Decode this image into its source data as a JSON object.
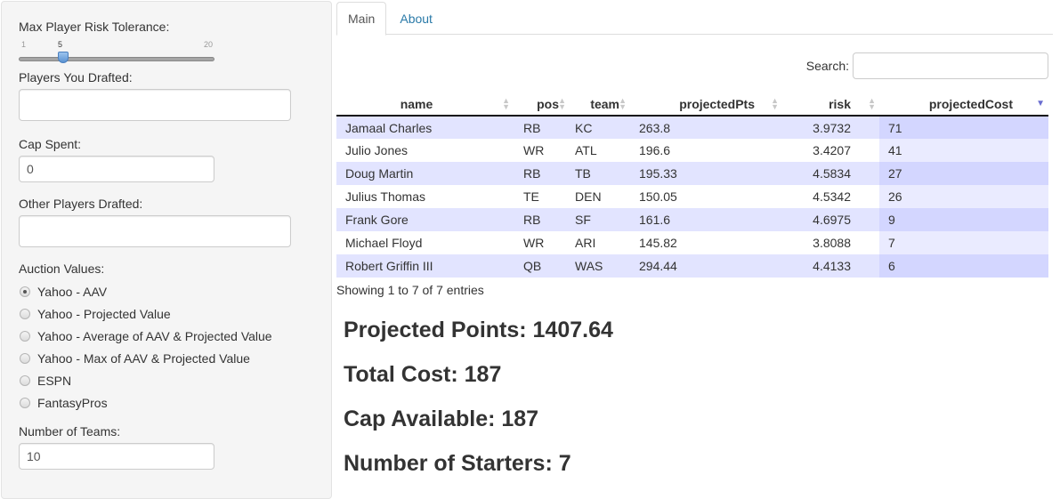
{
  "sidebar": {
    "risk_slider": {
      "label": "Max Player Risk Tolerance:",
      "min": 1,
      "max": 20,
      "value": 5,
      "min_label": "1",
      "max_label": "20",
      "value_label": "5"
    },
    "players_drafted": {
      "label": "Players You Drafted:",
      "value": ""
    },
    "cap_spent": {
      "label": "Cap Spent:",
      "value": "0"
    },
    "other_players": {
      "label": "Other Players Drafted:",
      "value": ""
    },
    "auction_values": {
      "label": "Auction Values:",
      "selected": 0,
      "options": [
        "Yahoo - AAV",
        "Yahoo - Projected Value",
        "Yahoo - Average of AAV & Projected Value",
        "Yahoo - Max of AAV & Projected Value",
        "ESPN",
        "FantasyPros"
      ]
    },
    "num_teams": {
      "label": "Number of Teams:",
      "value": "10"
    }
  },
  "tabs": [
    {
      "label": "Main",
      "active": true
    },
    {
      "label": "About",
      "active": false
    }
  ],
  "search": {
    "label": "Search:",
    "value": ""
  },
  "table": {
    "columns": [
      "name",
      "pos",
      "team",
      "projectedPts",
      "risk",
      "projectedCost"
    ],
    "sorted_column": "projectedCost",
    "sort_direction": "desc",
    "rows": [
      [
        "Jamaal Charles",
        "RB",
        "KC",
        "263.8",
        "3.9732",
        "71"
      ],
      [
        "Julio Jones",
        "WR",
        "ATL",
        "196.6",
        "3.4207",
        "41"
      ],
      [
        "Doug Martin",
        "RB",
        "TB",
        "195.33",
        "4.5834",
        "27"
      ],
      [
        "Julius Thomas",
        "TE",
        "DEN",
        "150.05",
        "4.5342",
        "26"
      ],
      [
        "Frank Gore",
        "RB",
        "SF",
        "161.6",
        "4.6975",
        "9"
      ],
      [
        "Michael Floyd",
        "WR",
        "ARI",
        "145.82",
        "3.8088",
        "7"
      ],
      [
        "Robert Griffin III",
        "QB",
        "WAS",
        "294.44",
        "4.4133",
        "6"
      ]
    ],
    "info": "Showing 1 to 7 of 7 entries"
  },
  "summary": {
    "projected_points": "Projected Points: 1407.64",
    "total_cost": "Total Cost: 187",
    "cap_available": "Cap Available: 187",
    "num_starters": "Number of Starters: 7"
  },
  "colors": {
    "row_odd": "#e2e4ff",
    "row_even": "#ffffff",
    "sorted_odd": "#d3d6ff",
    "sorted_even": "#eaebff",
    "link": "#2a7aa8"
  }
}
